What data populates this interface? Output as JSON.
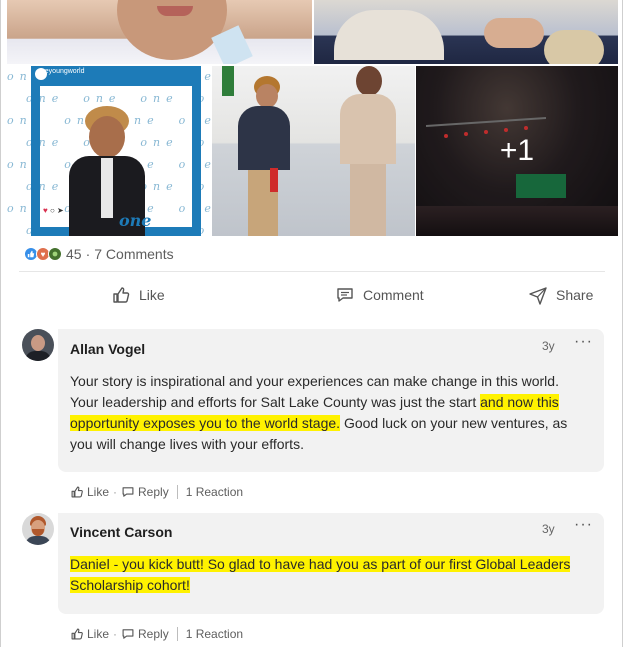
{
  "photos": {
    "overflow_label": "+1",
    "frame_header": "oneyoungworld",
    "frame_logo": "one"
  },
  "reactions": {
    "count_text": "45",
    "separator": "·",
    "comments_text": "7 Comments",
    "icons": [
      "like-icon",
      "love-icon",
      "support-icon"
    ]
  },
  "actions": {
    "like_label": "Like",
    "comment_label": "Comment",
    "share_label": "Share"
  },
  "comments": [
    {
      "name": "Allan Vogel",
      "time": "3y",
      "more": "···",
      "text_before": "Your story is inspirational and your experiences can make change in this world. Your leadership and efforts for Salt Lake County was just the start ",
      "text_highlight": "and now this opportunity exposes you to the world stage.",
      "text_after": " Good luck on your new ventures, as you will change lives with your efforts.",
      "like_label": "Like",
      "reply_label": "Reply",
      "reaction_label": "1 Reaction"
    },
    {
      "name": "Vincent Carson",
      "time": "3y",
      "more": "···",
      "text_highlight": "Daniel - you kick butt! So glad to have had you as part of our first Global Leaders Scholarship cohort!",
      "like_label": "Like",
      "reply_label": "Reply",
      "reaction_label": "1 Reaction"
    }
  ],
  "colors": {
    "highlight": "#fff200",
    "like_blue": "#378fe9",
    "love_red": "#df704d",
    "support_green": "#44712e",
    "bubble_bg": "#f2f2f2"
  }
}
